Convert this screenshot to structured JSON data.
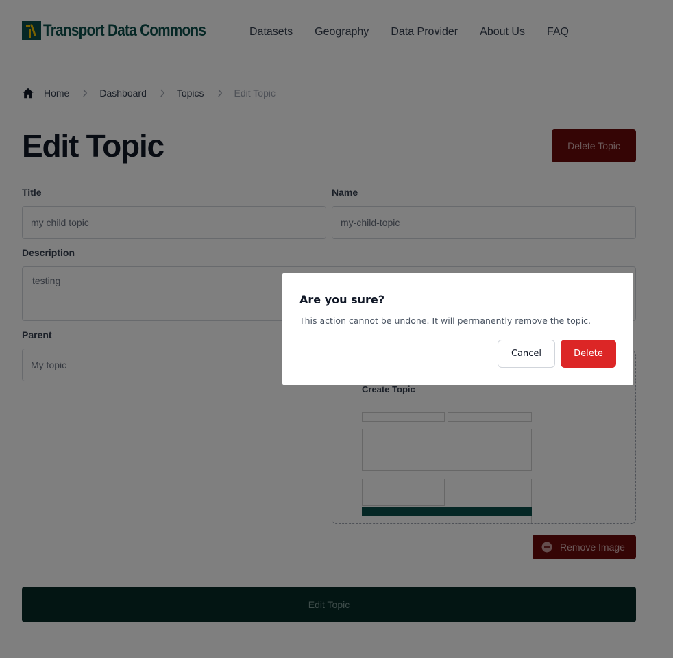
{
  "header": {
    "logo_text": "Transport Data Commons",
    "nav": [
      "Datasets",
      "Geography",
      "Data Provider",
      "About Us",
      "FAQ"
    ]
  },
  "breadcrumb": {
    "home": "Home",
    "dashboard": "Dashboard",
    "topics": "Topics",
    "current": "Edit Topic"
  },
  "page": {
    "title": "Edit Topic",
    "delete_button": "Delete Topic"
  },
  "form": {
    "title_label": "Title",
    "title_value": "my child topic",
    "name_label": "Name",
    "name_value": "my-child-topic",
    "description_label": "Description",
    "description_value": "testing",
    "parent_label": "Parent",
    "parent_value": "My topic",
    "image_preview": {
      "title": "Create Topic"
    },
    "remove_image_button": "Remove Image",
    "submit_button": "Edit Topic"
  },
  "modal": {
    "title": "Are you sure?",
    "body": "This action cannot be undone. It will permanently remove the topic.",
    "cancel_label": "Cancel",
    "confirm_label": "Delete"
  },
  "colors": {
    "brand": "#0b4f4a",
    "danger": "#dc2626",
    "danger_dark": "#6b0a0a"
  }
}
